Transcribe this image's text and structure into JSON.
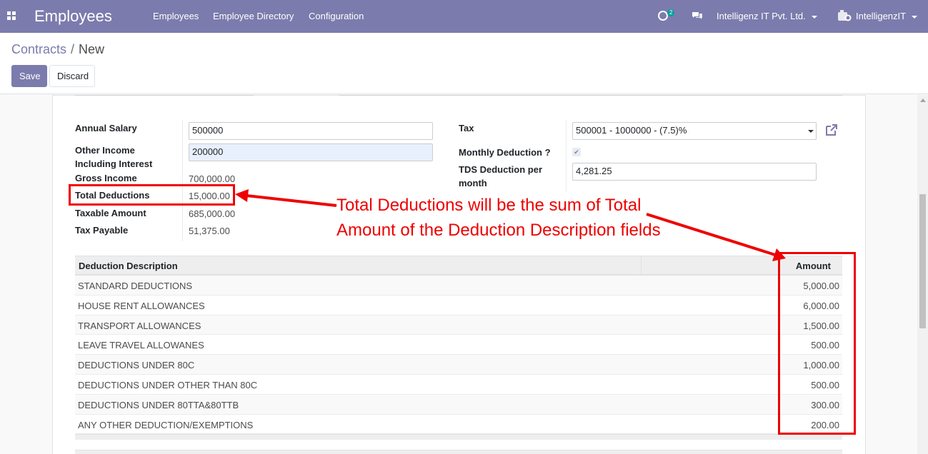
{
  "navbar": {
    "brand": "Employees",
    "menu": [
      "Employees",
      "Employee Directory",
      "Configuration"
    ],
    "activity_count": "2",
    "company": "Intelligenz IT Pvt. Ltd.",
    "user": "IntelligenzIT",
    "color": "#7c7bad"
  },
  "breadcrumb": {
    "parent": "Contracts",
    "current": "New"
  },
  "buttons": {
    "save": "Save",
    "discard": "Discard"
  },
  "form": {
    "annual_salary": {
      "label": "Annual Salary",
      "value": "500000"
    },
    "other_income": {
      "label_line1": "Other Income",
      "label_line2": "Including Interest",
      "value": "200000"
    },
    "gross_income": {
      "label": "Gross Income",
      "value": "700,000.00"
    },
    "total_deductions": {
      "label": "Total Deductions",
      "value": "15,000.00"
    },
    "taxable_amount": {
      "label": "Taxable Amount",
      "value": "685,000.00"
    },
    "tax_payable": {
      "label": "Tax Payable",
      "value": "51,375.00"
    },
    "tax": {
      "label": "Tax",
      "value": "500001 - 1000000 - (7.5)%"
    },
    "monthly_deduction": {
      "label": "Monthly Deduction ?",
      "checked": true
    },
    "tds": {
      "label_line1": "TDS Deduction per",
      "label_line2": "month",
      "value": "4,281.25"
    }
  },
  "deductions": {
    "col_desc": "Deduction Description",
    "col_amount": "Amount",
    "rows": [
      {
        "desc": "STANDARD DEDUCTIONS",
        "amount": "5,000.00"
      },
      {
        "desc": "HOUSE RENT ALLOWANCES",
        "amount": "6,000.00"
      },
      {
        "desc": "TRANSPORT ALLOWANCES",
        "amount": "1,500.00"
      },
      {
        "desc": "LEAVE TRAVEL ALLOWANES",
        "amount": "500.00"
      },
      {
        "desc": "DEDUCTIONS UNDER 80C",
        "amount": "1,000.00"
      },
      {
        "desc": "DEDUCTIONS UNDER OTHER THAN 80C",
        "amount": "500.00"
      },
      {
        "desc": "DEDUCTIONS UNDER 80TTA&80TTB",
        "amount": "300.00"
      },
      {
        "desc": "ANY OTHER DEDUCTION/EXEMPTIONS",
        "amount": "200.00"
      }
    ]
  },
  "annotation": {
    "line1": "Total Deductions will be the sum of Total",
    "line2": "Amount of the Deduction Description fields",
    "color": "#ee0000"
  }
}
